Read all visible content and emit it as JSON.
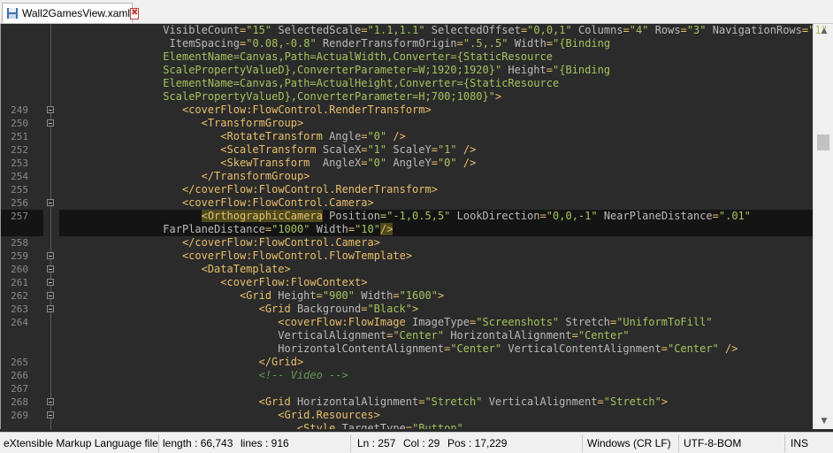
{
  "tab": {
    "title": "Wall2GamesView.xaml",
    "close_glyph": "✖"
  },
  "editor": {
    "lines": [
      {
        "num": "",
        "indent": 15,
        "tokens": [
          [
            "attr",
            "VisibleCount"
          ],
          [
            "punc",
            "="
          ],
          [
            "val",
            "\"15\""
          ],
          [
            "attr",
            " SelectedScale"
          ],
          [
            "punc",
            "="
          ],
          [
            "val",
            "\"1.1,1.1\""
          ],
          [
            "attr",
            " SelectedOffset"
          ],
          [
            "punc",
            "="
          ],
          [
            "val",
            "\"0,0,1\""
          ],
          [
            "attr",
            " Columns"
          ],
          [
            "punc",
            "="
          ],
          [
            "val",
            "\"4\""
          ],
          [
            "attr",
            " Rows"
          ],
          [
            "punc",
            "="
          ],
          [
            "val",
            "\"3\""
          ],
          [
            "attr",
            " NavigationRows"
          ],
          [
            "punc",
            "="
          ],
          [
            "val",
            "\"1\""
          ]
        ]
      },
      {
        "num": "",
        "indent": 16,
        "tokens": [
          [
            "attr",
            "ItemSpacing"
          ],
          [
            "punc",
            "="
          ],
          [
            "val",
            "\"0.08,-0.8\""
          ],
          [
            "attr",
            " RenderTransformOrigin"
          ],
          [
            "punc",
            "="
          ],
          [
            "val",
            "\".5,.5\""
          ],
          [
            "attr",
            " Width"
          ],
          [
            "punc",
            "="
          ],
          [
            "val",
            "\"{Binding"
          ]
        ]
      },
      {
        "num": "",
        "indent": 15,
        "tokens": [
          [
            "val",
            "ElementName=Canvas,Path=ActualWidth,Converter={StaticResource"
          ]
        ]
      },
      {
        "num": "",
        "indent": 15,
        "tokens": [
          [
            "val",
            "ScalePropertyValueD},ConverterParameter=W;1920;1920}\""
          ],
          [
            "attr",
            " Height"
          ],
          [
            "punc",
            "="
          ],
          [
            "val",
            "\"{Binding"
          ]
        ]
      },
      {
        "num": "",
        "indent": 15,
        "tokens": [
          [
            "val",
            "ElementName=Canvas,Path=ActualHeight,Converter={StaticResource"
          ]
        ]
      },
      {
        "num": "",
        "indent": 15,
        "tokens": [
          [
            "val",
            "ScalePropertyValueD},ConverterParameter=H;700;1080}\""
          ],
          [
            "punc",
            ">"
          ]
        ]
      },
      {
        "num": "249",
        "indent": 18,
        "fold": true,
        "tokens": [
          [
            "tag",
            "<coverFlow:FlowControl.RenderTransform>"
          ]
        ]
      },
      {
        "num": "250",
        "indent": 21,
        "fold": true,
        "tokens": [
          [
            "tag",
            "<TransformGroup>"
          ]
        ]
      },
      {
        "num": "251",
        "indent": 24,
        "tokens": [
          [
            "tag",
            "<RotateTransform"
          ],
          [
            "attr",
            " Angle"
          ],
          [
            "punc",
            "="
          ],
          [
            "val",
            "\"0\""
          ],
          [
            "tag",
            " />"
          ]
        ]
      },
      {
        "num": "252",
        "indent": 24,
        "tokens": [
          [
            "tag",
            "<ScaleTransform"
          ],
          [
            "attr",
            " ScaleX"
          ],
          [
            "punc",
            "="
          ],
          [
            "val",
            "\"1\""
          ],
          [
            "attr",
            " ScaleY"
          ],
          [
            "punc",
            "="
          ],
          [
            "val",
            "\"1\""
          ],
          [
            "tag",
            " />"
          ]
        ]
      },
      {
        "num": "253",
        "indent": 24,
        "tokens": [
          [
            "tag",
            "<SkewTransform"
          ],
          [
            "attr",
            "  AngleX"
          ],
          [
            "punc",
            "="
          ],
          [
            "val",
            "\"0\""
          ],
          [
            "attr",
            " AngleY"
          ],
          [
            "punc",
            "="
          ],
          [
            "val",
            "\"0\""
          ],
          [
            "tag",
            " />"
          ]
        ]
      },
      {
        "num": "254",
        "indent": 21,
        "tokens": [
          [
            "tag",
            "</TransformGroup>"
          ]
        ]
      },
      {
        "num": "255",
        "indent": 18,
        "tokens": [
          [
            "tag",
            "</coverFlow:FlowControl.RenderTransform>"
          ]
        ]
      },
      {
        "num": "256",
        "indent": 18,
        "fold": true,
        "tokens": [
          [
            "tag",
            "<coverFlow:FlowControl.Camera>"
          ]
        ]
      },
      {
        "num": "257",
        "indent": 21,
        "current": true,
        "tokens": [
          [
            "tagm",
            "<OrthographicCamera"
          ],
          [
            "attr",
            " Position"
          ],
          [
            "punc",
            "="
          ],
          [
            "val",
            "\"-1,0.5,5\""
          ],
          [
            "attr",
            " LookDirection"
          ],
          [
            "punc",
            "="
          ],
          [
            "val",
            "\"0,0,-1\""
          ],
          [
            "attr",
            " NearPlaneDistance"
          ],
          [
            "punc",
            "="
          ],
          [
            "val",
            "\".01\""
          ]
        ]
      },
      {
        "num": "",
        "indent": 15,
        "current": true,
        "tokens": [
          [
            "attr",
            "FarPlaneDistance"
          ],
          [
            "punc",
            "="
          ],
          [
            "val",
            "\"1000\""
          ],
          [
            "attr",
            " Width"
          ],
          [
            "punc",
            "="
          ],
          [
            "val",
            "\"10\""
          ],
          [
            "tagm",
            "/>"
          ]
        ]
      },
      {
        "num": "258",
        "indent": 18,
        "tokens": [
          [
            "tag",
            "</coverFlow:FlowControl.Camera>"
          ]
        ]
      },
      {
        "num": "259",
        "indent": 18,
        "fold": true,
        "tokens": [
          [
            "tag",
            "<coverFlow:FlowControl.FlowTemplate>"
          ]
        ]
      },
      {
        "num": "260",
        "indent": 21,
        "fold": true,
        "tokens": [
          [
            "tag",
            "<DataTemplate>"
          ]
        ]
      },
      {
        "num": "261",
        "indent": 24,
        "fold": true,
        "tokens": [
          [
            "tag",
            "<coverFlow:FlowContext>"
          ]
        ]
      },
      {
        "num": "262",
        "indent": 27,
        "fold": true,
        "tokens": [
          [
            "tag",
            "<Grid"
          ],
          [
            "attr",
            " Height"
          ],
          [
            "punc",
            "="
          ],
          [
            "val",
            "\"900\""
          ],
          [
            "attr",
            " Width"
          ],
          [
            "punc",
            "="
          ],
          [
            "val",
            "\"1600\""
          ],
          [
            "tag",
            ">"
          ]
        ]
      },
      {
        "num": "263",
        "indent": 30,
        "fold": true,
        "tokens": [
          [
            "tag",
            "<Grid"
          ],
          [
            "attr",
            " Background"
          ],
          [
            "punc",
            "="
          ],
          [
            "val",
            "\"Black\""
          ],
          [
            "tag",
            ">"
          ]
        ]
      },
      {
        "num": "264",
        "indent": 33,
        "tokens": [
          [
            "tag",
            "<coverFlow:FlowImage"
          ],
          [
            "attr",
            " ImageType"
          ],
          [
            "punc",
            "="
          ],
          [
            "val",
            "\"Screenshots\""
          ],
          [
            "attr",
            " Stretch"
          ],
          [
            "punc",
            "="
          ],
          [
            "val",
            "\"UniformToFill\""
          ]
        ]
      },
      {
        "num": "",
        "indent": 33,
        "tokens": [
          [
            "attr",
            "VerticalAlignment"
          ],
          [
            "punc",
            "="
          ],
          [
            "val",
            "\"Center\""
          ],
          [
            "attr",
            " HorizontalAlignment"
          ],
          [
            "punc",
            "="
          ],
          [
            "val",
            "\"Center\""
          ]
        ]
      },
      {
        "num": "",
        "indent": 33,
        "tokens": [
          [
            "attr",
            "HorizontalContentAlignment"
          ],
          [
            "punc",
            "="
          ],
          [
            "val",
            "\"Center\""
          ],
          [
            "attr",
            " VerticalContentAlignment"
          ],
          [
            "punc",
            "="
          ],
          [
            "val",
            "\"Center\""
          ],
          [
            "tag",
            " />"
          ]
        ]
      },
      {
        "num": "265",
        "indent": 30,
        "tokens": [
          [
            "tag",
            "</Grid>"
          ]
        ]
      },
      {
        "num": "266",
        "indent": 30,
        "tokens": [
          [
            "cmt",
            "<!-- Video -->"
          ]
        ]
      },
      {
        "num": "267",
        "indent": 0,
        "tokens": []
      },
      {
        "num": "268",
        "indent": 30,
        "fold": true,
        "tokens": [
          [
            "tag",
            "<Grid"
          ],
          [
            "attr",
            " HorizontalAlignment"
          ],
          [
            "punc",
            "="
          ],
          [
            "val",
            "\"Stretch\""
          ],
          [
            "attr",
            " VerticalAlignment"
          ],
          [
            "punc",
            "="
          ],
          [
            "val",
            "\"Stretch\""
          ],
          [
            "tag",
            ">"
          ]
        ]
      },
      {
        "num": "269",
        "indent": 33,
        "fold": true,
        "tokens": [
          [
            "tag",
            "<Grid.Resources>"
          ]
        ]
      },
      {
        "num": "",
        "indent": 36,
        "tokens": [
          [
            "tag",
            "<Style"
          ],
          [
            "attr",
            " TargetType"
          ],
          [
            "punc",
            "="
          ],
          [
            "val",
            "\"Button\""
          ]
        ]
      }
    ]
  },
  "status": {
    "file_type": "eXtensible Markup Language file",
    "length": "length : 66,743",
    "lines": "lines : 916",
    "ln": "Ln : 257",
    "col": "Col : 29",
    "pos": "Pos : 17,229",
    "eol": "Windows (CR LF)",
    "encoding": "UTF-8-BOM",
    "mode": "INS"
  }
}
